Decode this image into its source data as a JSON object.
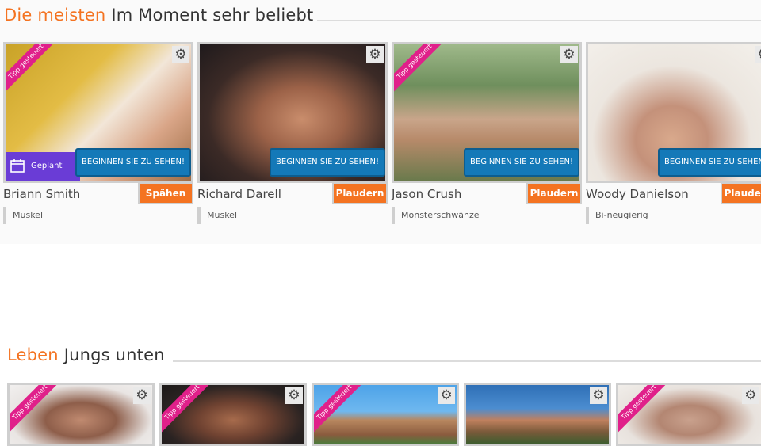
{
  "section1": {
    "title_accent": "Die meisten",
    "title_rest": "Im Moment sehr beliebt",
    "cards": [
      {
        "name": "Briann Smith",
        "action": "Spähen",
        "tag": "Muskel",
        "tipp": "Tipp gesteuert",
        "watch": "BEGINNEN SIE ZU SEHEN!",
        "scheduled": "Geplant"
      },
      {
        "name": "Richard Darell",
        "action": "Plaudern",
        "tag": "Muskel",
        "watch": "BEGINNEN SIE ZU SEHEN!"
      },
      {
        "name": "Jason Crush",
        "action": "Plaudern",
        "tag": "Monsterschwänze",
        "tipp": "Tipp gesteuert",
        "watch": "BEGINNEN SIE ZU SEHEN!"
      },
      {
        "name": "Woody Danielson",
        "action": "Plaudern",
        "tag": "Bi-neugierig",
        "watch": "BEGINNEN SIE ZU SEHEN!"
      }
    ]
  },
  "section2": {
    "title_accent": "Leben",
    "title_rest": "Jungs unten",
    "cards": [
      {
        "tipp": "Tipp gesteuert"
      },
      {
        "tipp": "Tipp gesteuert"
      },
      {
        "tipp": "Tipp gesteuert"
      },
      {},
      {
        "tipp": "Tipp gesteuert"
      }
    ]
  },
  "icons": {
    "settings": "gear-icon",
    "calendar": "calendar-icon"
  },
  "colors": {
    "accent": "#f47321",
    "watch_button": "#1479b8",
    "tipp_ribbon": "#e0208a",
    "scheduled": "#6a3cd6"
  }
}
